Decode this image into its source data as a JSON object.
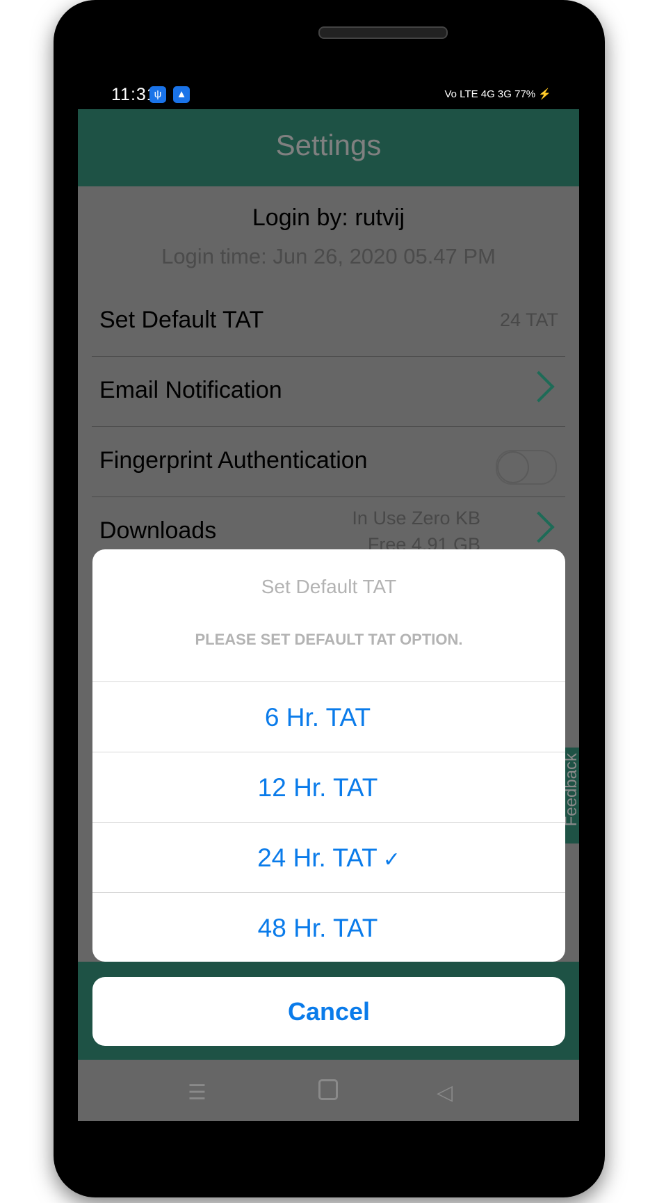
{
  "status_bar": {
    "time": "11:31",
    "battery": "77%",
    "network": "Vo LTE 4G 3G"
  },
  "header": {
    "title": "Settings"
  },
  "login": {
    "by": "Login by: rutvij",
    "time": "Login time: Jun 26, 2020 05.47 PM"
  },
  "settings": {
    "default_tat": {
      "label": "Set Default TAT",
      "value": "24 TAT"
    },
    "email": {
      "label": "Email Notification"
    },
    "fingerprint": {
      "label": "Fingerprint Authentication",
      "enabled": false
    },
    "downloads": {
      "label": "Downloads",
      "in_use": "In Use Zero KB",
      "free": "Free 4.91 GB"
    }
  },
  "feedback_tab": "Feedback",
  "dialog": {
    "title": "Set Default TAT",
    "message": "PLEASE SET DEFAULT TAT OPTION.",
    "options": [
      {
        "label": "6 Hr. TAT",
        "selected": false
      },
      {
        "label": "12 Hr. TAT",
        "selected": false
      },
      {
        "label": "24 Hr. TAT",
        "selected": true,
        "check": "✓"
      },
      {
        "label": "48 Hr. TAT",
        "selected": false
      }
    ],
    "cancel": "Cancel"
  },
  "colors": {
    "header": "#1e5245",
    "accent_blue": "#0a7bea",
    "chevron": "#1e6b57"
  }
}
